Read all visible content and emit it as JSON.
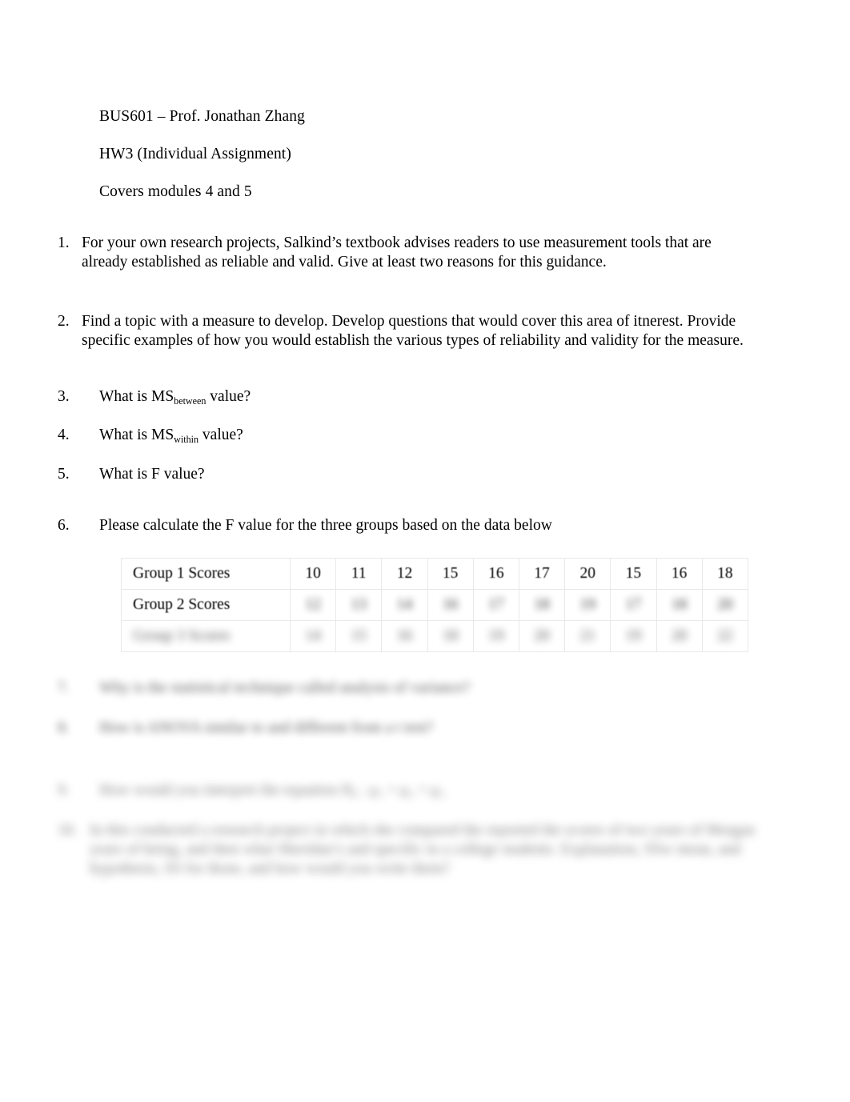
{
  "document": {
    "header": {
      "course_instructor": "BUS601 – Prof. Jonathan Zhang",
      "assignment": "HW3 (Individual Assignment)",
      "coverage": "Covers modules 4 and 5"
    },
    "questions": [
      {
        "number": "1.",
        "text": "For your own research projects, Salkind’s textbook advises readers to use measurement tools that are already established as reliable and valid. Give at least two reasons for this guidance."
      },
      {
        "number": "2.",
        "text": "Find a topic with a measure to develop. Develop questions that would cover this area of itnerest. Provide specific examples of how you would establish the various types of reliability and validity for the measure."
      },
      {
        "number": "3.",
        "text_before": "What is MS",
        "subscript": "between",
        "text_after": " value?"
      },
      {
        "number": "4.",
        "text_before": "What is  MS",
        "subscript": "within",
        "text_after": " value?"
      },
      {
        "number": "5.",
        "text": "What is  F value?"
      },
      {
        "number": "6.",
        "text": "Please calculate the F value for the three groups based on the data below"
      },
      {
        "number": "7.",
        "text": "Why is the statistical technique called analysis of variance?"
      },
      {
        "number": "8.",
        "text": "How is ANOVA similar to and different from a t test?"
      },
      {
        "number": "9.",
        "text": "How would you interpret the equation",
        "equation": "H₀ : μ₁ = μ₂ = μ₃"
      },
      {
        "number": "10.",
        "text": "In this conducted a research project in which she compared the reported the scores of two years of Morgan years of being, and then what Sheridan’s and specific in a college students. Explanation, SSw mean, and hypothesis, SS for those, and how would you write them?"
      }
    ],
    "table": {
      "rows": [
        {
          "label": "Group 1 Scores",
          "values": [
            "10",
            "11",
            "12",
            "15",
            "16",
            "17",
            "20",
            "15",
            "16",
            "18"
          ]
        },
        {
          "label": "Group 2 Scores",
          "values": [
            "12",
            "13",
            "14",
            "16",
            "17",
            "18",
            "19",
            "17",
            "18",
            "20"
          ]
        },
        {
          "label": "Group 3 Scores",
          "values": [
            "14",
            "15",
            "16",
            "18",
            "19",
            "20",
            "21",
            "19",
            "20",
            "22"
          ]
        }
      ]
    }
  }
}
